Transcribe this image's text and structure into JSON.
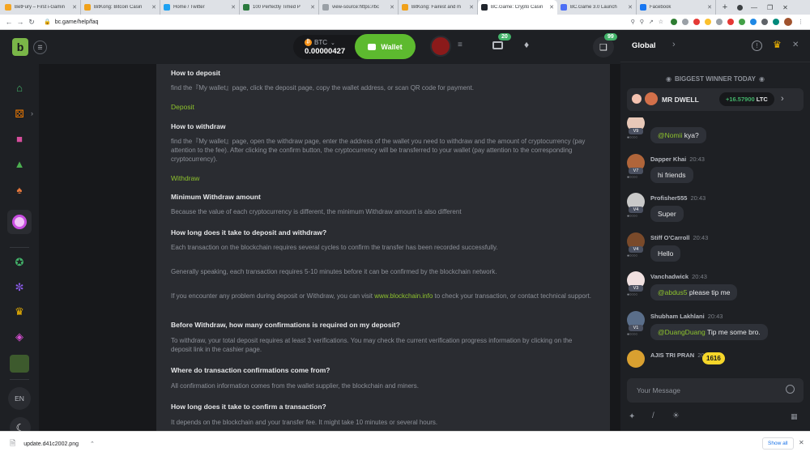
{
  "browser": {
    "tabs": [
      {
        "label": "BetFury – First i-Gamin",
        "color": "#f5a623"
      },
      {
        "label": "BitKong: Bitcoin Casin",
        "color": "#f0a11a"
      },
      {
        "label": "Home / Twitter",
        "color": "#1da1f2"
      },
      {
        "label": "100 Perfectly Timed P",
        "color": "#2b7a3e"
      },
      {
        "label": "view-source:https://bc",
        "color": "#9aa0a6"
      },
      {
        "label": "BitKong: Fairest and m",
        "color": "#f0a11a"
      },
      {
        "label": "BC.Game: Crypto Casin",
        "color": "#21262d"
      },
      {
        "label": "BC.Game 3.0 Launch",
        "color": "#4c6ef5"
      },
      {
        "label": "Facebook",
        "color": "#1877f2"
      }
    ],
    "url": "bc.game/help/faq"
  },
  "header": {
    "currency": "BTC",
    "balance": "0.00000427",
    "wallet_label": "Wallet",
    "mail_count": "20",
    "chat_count": "99"
  },
  "leftnav": {
    "lang": "EN"
  },
  "faq": {
    "deposit_title": "How to deposit",
    "deposit_text": "find the『My wallet』page, click the deposit page, copy the wallet address, or scan QR code for payment.",
    "deposit_link": "Deposit",
    "withdraw_title": "How to withdraw",
    "withdraw_text": "find the『My wallet』page, open the withdraw page, enter the address of the wallet you need to withdraw and the amount of cryptocurrency (pay attention to the fee). After clicking the confirm button, the cryptocurrency will be transferred to your wallet (pay attention to the corresponding cryptocurrency).",
    "withdraw_link": "Withdraw",
    "min_title": "Minimum Withdraw amount",
    "min_text": "Because the value of each cryptocurrency is different, the minimum Withdraw amount is also different",
    "howlong_title": "How long does it take to deposit and withdraw?",
    "howlong_text1": "Each transaction on the blockchain requires several cycles to confirm the transfer has been recorded successfully.",
    "howlong_text2": "Generally speaking, each transaction requires 5-10 minutes before it can be confirmed by the blockchain network.",
    "howlong_text3_pre": "If you encounter any problem during deposit or Withdraw, you can visit ",
    "howlong_text3_link": "www.blockchain.info",
    "howlong_text3_post": " to check your transaction, or contact technical support.",
    "confirm_title": "Before Withdraw, how many confirmations is required on my deposit?",
    "confirm_text": "To withdraw, your total deposit requires at least 3 verifications. You may check the current verification progress information by clicking on the deposit link in the cashier page.",
    "where_title": "Where do transaction confirmations come from?",
    "where_text": "All confirmation information comes from the wallet supplier, the blockchain and miners.",
    "howlongconf_title": "How long does it take to confirm a transaction?",
    "howlongconf_text": "It depends on the blockchain and your transfer fee. It might take 10 minutes or several hours."
  },
  "chat": {
    "tab_global": "Global",
    "winner_title": "BIGGEST WINNER TODAY",
    "winner_name": "MR DWELL",
    "winner_amount": "+16.57900",
    "winner_currency": "LTC",
    "messages": [
      {
        "name": "",
        "time": "",
        "level": "V9",
        "mention": "@Nomii",
        "text": " kya?"
      },
      {
        "name": "Dapper Khai",
        "time": "20:43",
        "level": "V7",
        "mention": "",
        "text": "hi friends"
      },
      {
        "name": "Profisher555",
        "time": "20:43",
        "level": "V4",
        "mention": "",
        "text": "Super"
      },
      {
        "name": "Stiff O'Carroll",
        "time": "20:43",
        "level": "V4",
        "mention": "",
        "text": "Hello"
      },
      {
        "name": "Vanchadwick",
        "time": "20:43",
        "level": "V3",
        "mention": "@abdus5",
        "text": " please tip me"
      },
      {
        "name": "Shubham Lakhlani",
        "time": "20:43",
        "level": "V1",
        "mention": "@DuangDuang",
        "text": " Tip me some bro."
      },
      {
        "name": "AJIS TRI PRAN",
        "time": "20:43",
        "level": "",
        "mention": "",
        "text": ""
      }
    ],
    "unread": "1616",
    "input_placeholder": "Your Message"
  },
  "downloads": {
    "file": "update.d41c2002.png",
    "show_all": "Show all"
  }
}
